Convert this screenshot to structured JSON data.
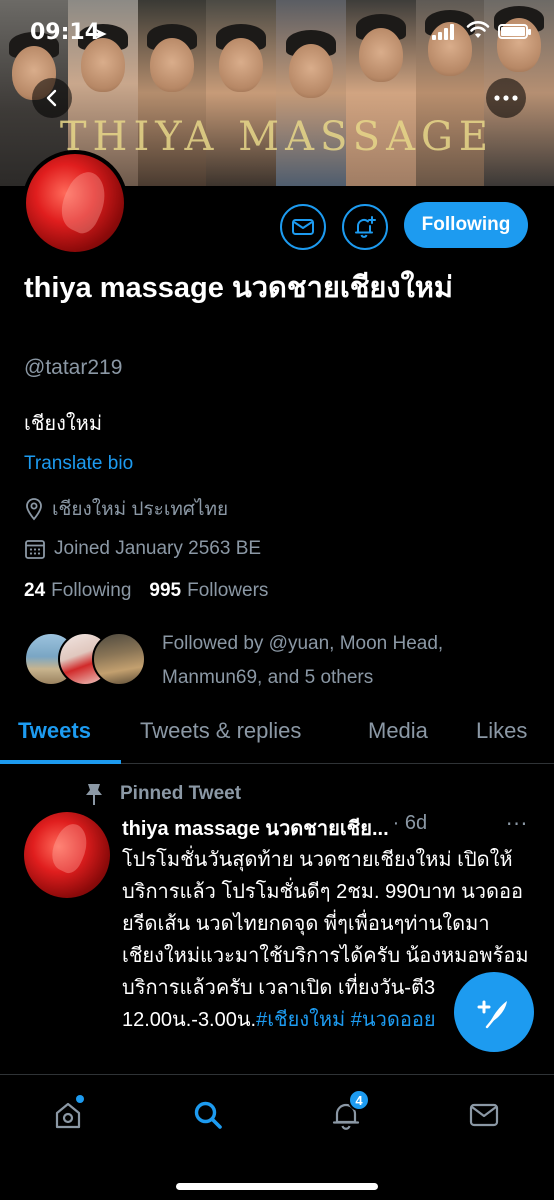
{
  "status_bar": {
    "time": "09:14"
  },
  "banner": {
    "title": "THIYA MASSAGE"
  },
  "profile": {
    "display_name": "thiya massage นวดชายเชียงใหม่",
    "handle": "@tatar219",
    "bio": "เชียงใหม่",
    "translate_label": "Translate bio",
    "location": "เชียงใหม่ ประเทศไทย",
    "joined": "Joined January 2563 BE",
    "following_count": "24",
    "following_label": "Following",
    "followers_count": "995",
    "followers_label": "Followers",
    "followed_by": "Followed by @yuan, Moon Head, Manmun69, and 5 others",
    "follow_button_label": "Following"
  },
  "tabs": [
    {
      "label": "Tweets",
      "active": true
    },
    {
      "label": "Tweets & replies",
      "active": false
    },
    {
      "label": "Media",
      "active": false
    },
    {
      "label": "Likes",
      "active": false
    }
  ],
  "pinned_tweet": {
    "pinned_label": "Pinned Tweet",
    "author": "thiya massage นวดชายเชีย...",
    "time": "· 6d",
    "more": "···",
    "text": "โปรโมชั่นวันสุดท้าย นวดชายเชียงใหม่ เปิดให้บริการแล้ว โปรโมชั่นดีๆ 2ชม. 990บาท นวดออยรีดเส้น นวดไทยกดจุด พี่ๆเพื่อนๆท่านใดมาเชียงใหม่แวะมาใช้บริการได้ครับ น้องหมอพร้อมบริการแล้วครับ  เวลาเปิด เที่ยงวัน-ตี3 12.00น.-3.00น.",
    "hashtags": "#เชียงใหม่ #นวดออย"
  },
  "bottom_nav": {
    "notification_badge": "4"
  },
  "colors": {
    "accent": "#1d9bf0",
    "background": "#000000",
    "secondary_text": "#8b98a5"
  }
}
